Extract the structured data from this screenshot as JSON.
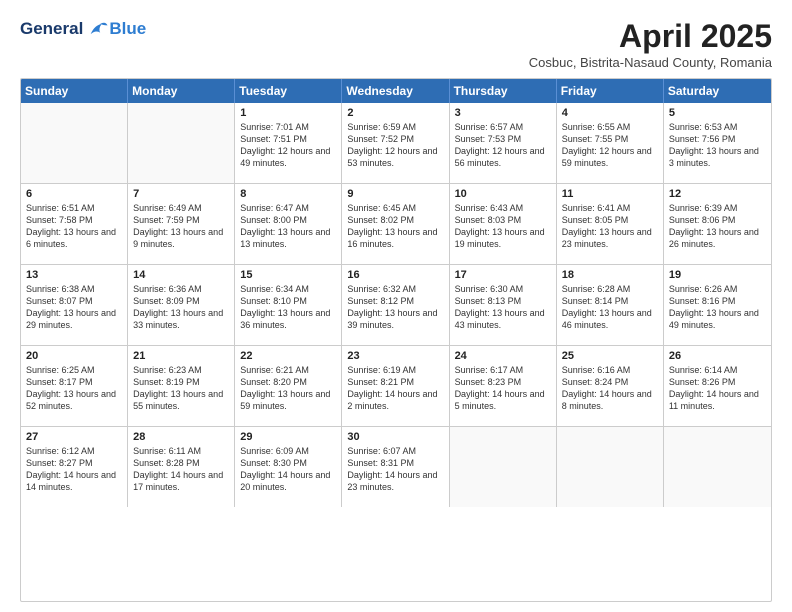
{
  "header": {
    "logo_general": "General",
    "logo_blue": "Blue",
    "title": "April 2025",
    "location": "Cosbuc, Bistrita-Nasaud County, Romania"
  },
  "calendar": {
    "days": [
      "Sunday",
      "Monday",
      "Tuesday",
      "Wednesday",
      "Thursday",
      "Friday",
      "Saturday"
    ],
    "rows": [
      [
        {
          "num": "",
          "info": ""
        },
        {
          "num": "",
          "info": ""
        },
        {
          "num": "1",
          "info": "Sunrise: 7:01 AM\nSunset: 7:51 PM\nDaylight: 12 hours and 49 minutes."
        },
        {
          "num": "2",
          "info": "Sunrise: 6:59 AM\nSunset: 7:52 PM\nDaylight: 12 hours and 53 minutes."
        },
        {
          "num": "3",
          "info": "Sunrise: 6:57 AM\nSunset: 7:53 PM\nDaylight: 12 hours and 56 minutes."
        },
        {
          "num": "4",
          "info": "Sunrise: 6:55 AM\nSunset: 7:55 PM\nDaylight: 12 hours and 59 minutes."
        },
        {
          "num": "5",
          "info": "Sunrise: 6:53 AM\nSunset: 7:56 PM\nDaylight: 13 hours and 3 minutes."
        }
      ],
      [
        {
          "num": "6",
          "info": "Sunrise: 6:51 AM\nSunset: 7:58 PM\nDaylight: 13 hours and 6 minutes."
        },
        {
          "num": "7",
          "info": "Sunrise: 6:49 AM\nSunset: 7:59 PM\nDaylight: 13 hours and 9 minutes."
        },
        {
          "num": "8",
          "info": "Sunrise: 6:47 AM\nSunset: 8:00 PM\nDaylight: 13 hours and 13 minutes."
        },
        {
          "num": "9",
          "info": "Sunrise: 6:45 AM\nSunset: 8:02 PM\nDaylight: 13 hours and 16 minutes."
        },
        {
          "num": "10",
          "info": "Sunrise: 6:43 AM\nSunset: 8:03 PM\nDaylight: 13 hours and 19 minutes."
        },
        {
          "num": "11",
          "info": "Sunrise: 6:41 AM\nSunset: 8:05 PM\nDaylight: 13 hours and 23 minutes."
        },
        {
          "num": "12",
          "info": "Sunrise: 6:39 AM\nSunset: 8:06 PM\nDaylight: 13 hours and 26 minutes."
        }
      ],
      [
        {
          "num": "13",
          "info": "Sunrise: 6:38 AM\nSunset: 8:07 PM\nDaylight: 13 hours and 29 minutes."
        },
        {
          "num": "14",
          "info": "Sunrise: 6:36 AM\nSunset: 8:09 PM\nDaylight: 13 hours and 33 minutes."
        },
        {
          "num": "15",
          "info": "Sunrise: 6:34 AM\nSunset: 8:10 PM\nDaylight: 13 hours and 36 minutes."
        },
        {
          "num": "16",
          "info": "Sunrise: 6:32 AM\nSunset: 8:12 PM\nDaylight: 13 hours and 39 minutes."
        },
        {
          "num": "17",
          "info": "Sunrise: 6:30 AM\nSunset: 8:13 PM\nDaylight: 13 hours and 43 minutes."
        },
        {
          "num": "18",
          "info": "Sunrise: 6:28 AM\nSunset: 8:14 PM\nDaylight: 13 hours and 46 minutes."
        },
        {
          "num": "19",
          "info": "Sunrise: 6:26 AM\nSunset: 8:16 PM\nDaylight: 13 hours and 49 minutes."
        }
      ],
      [
        {
          "num": "20",
          "info": "Sunrise: 6:25 AM\nSunset: 8:17 PM\nDaylight: 13 hours and 52 minutes."
        },
        {
          "num": "21",
          "info": "Sunrise: 6:23 AM\nSunset: 8:19 PM\nDaylight: 13 hours and 55 minutes."
        },
        {
          "num": "22",
          "info": "Sunrise: 6:21 AM\nSunset: 8:20 PM\nDaylight: 13 hours and 59 minutes."
        },
        {
          "num": "23",
          "info": "Sunrise: 6:19 AM\nSunset: 8:21 PM\nDaylight: 14 hours and 2 minutes."
        },
        {
          "num": "24",
          "info": "Sunrise: 6:17 AM\nSunset: 8:23 PM\nDaylight: 14 hours and 5 minutes."
        },
        {
          "num": "25",
          "info": "Sunrise: 6:16 AM\nSunset: 8:24 PM\nDaylight: 14 hours and 8 minutes."
        },
        {
          "num": "26",
          "info": "Sunrise: 6:14 AM\nSunset: 8:26 PM\nDaylight: 14 hours and 11 minutes."
        }
      ],
      [
        {
          "num": "27",
          "info": "Sunrise: 6:12 AM\nSunset: 8:27 PM\nDaylight: 14 hours and 14 minutes."
        },
        {
          "num": "28",
          "info": "Sunrise: 6:11 AM\nSunset: 8:28 PM\nDaylight: 14 hours and 17 minutes."
        },
        {
          "num": "29",
          "info": "Sunrise: 6:09 AM\nSunset: 8:30 PM\nDaylight: 14 hours and 20 minutes."
        },
        {
          "num": "30",
          "info": "Sunrise: 6:07 AM\nSunset: 8:31 PM\nDaylight: 14 hours and 23 minutes."
        },
        {
          "num": "",
          "info": ""
        },
        {
          "num": "",
          "info": ""
        },
        {
          "num": "",
          "info": ""
        }
      ]
    ]
  }
}
